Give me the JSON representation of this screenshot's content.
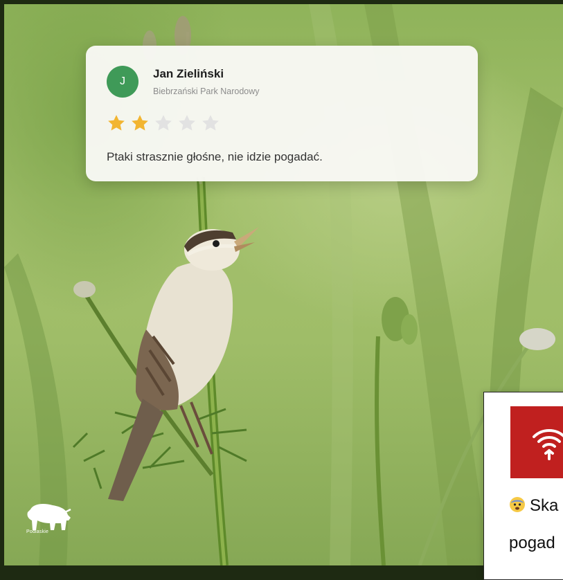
{
  "review": {
    "avatar_initial": "J",
    "name": "Jan Zieliński",
    "location": "Biebrzański Park Narodowy",
    "rating": 2,
    "max_rating": 5,
    "text": "Ptaki strasznie głośne, nie idzie pogadać."
  },
  "logo": {
    "text": "Podlaskie",
    "icon": "bison-icon"
  },
  "side_card": {
    "alert_icon": "wifi-signal-icon",
    "alert_color": "#c0201f",
    "emoji": "fearful-face-emoji",
    "line1": "Ska",
    "line2": "pogad"
  },
  "colors": {
    "star_filled": "#f2b531",
    "star_empty": "#e2e2e2",
    "avatar": "#3f9a58"
  }
}
